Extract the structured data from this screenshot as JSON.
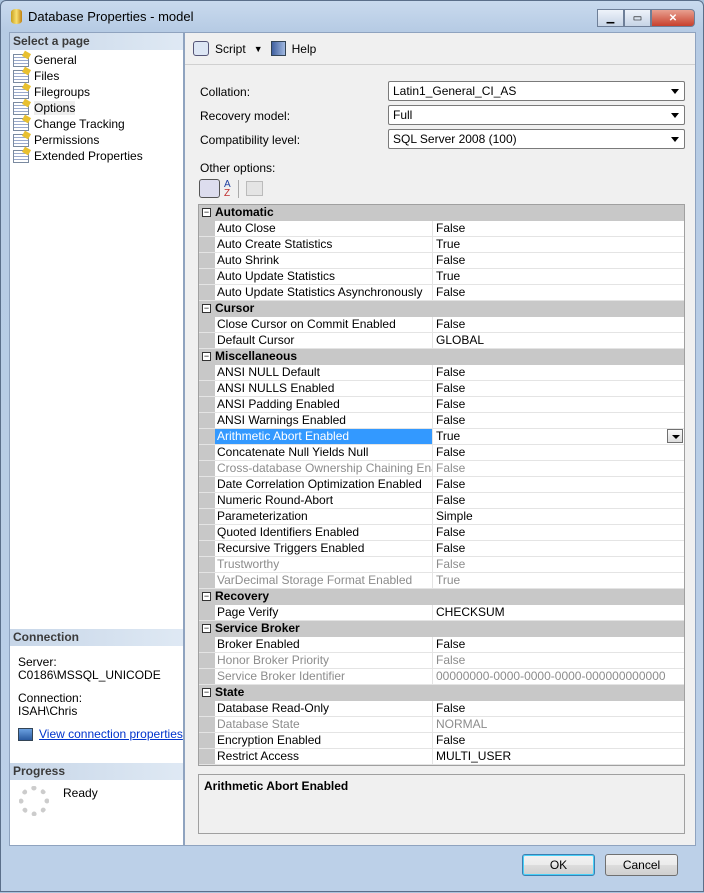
{
  "window": {
    "title": "Database Properties - model"
  },
  "left": {
    "select_header": "Select a page",
    "pages": [
      "General",
      "Files",
      "Filegroups",
      "Options",
      "Change Tracking",
      "Permissions",
      "Extended Properties"
    ],
    "selected": "Options",
    "connection_header": "Connection",
    "server_label": "Server:",
    "server": "C0186\\MSSQL_UNICODE",
    "connection_label": "Connection:",
    "connection": "ISAH\\Chris",
    "view_link": "View connection properties",
    "progress_header": "Progress",
    "progress_status": "Ready"
  },
  "toolbar": {
    "script": "Script",
    "help": "Help"
  },
  "form": {
    "collation_label": "Collation:",
    "collation": "Latin1_General_CI_AS",
    "recovery_label": "Recovery model:",
    "recovery": "Full",
    "compat_label": "Compatibility level:",
    "compat": "SQL Server 2008 (100)",
    "other_label": "Other options:"
  },
  "grid": [
    {
      "category": "Automatic",
      "rows": [
        [
          "Auto Close",
          "False"
        ],
        [
          "Auto Create Statistics",
          "True"
        ],
        [
          "Auto Shrink",
          "False"
        ],
        [
          "Auto Update Statistics",
          "True"
        ],
        [
          "Auto Update Statistics Asynchronously",
          "False"
        ]
      ]
    },
    {
      "category": "Cursor",
      "rows": [
        [
          "Close Cursor on Commit Enabled",
          "False"
        ],
        [
          "Default Cursor",
          "GLOBAL"
        ]
      ]
    },
    {
      "category": "Miscellaneous",
      "rows": [
        [
          "ANSI NULL Default",
          "False"
        ],
        [
          "ANSI NULLS Enabled",
          "False"
        ],
        [
          "ANSI Padding Enabled",
          "False"
        ],
        [
          "ANSI Warnings Enabled",
          "False"
        ],
        [
          "Arithmetic Abort Enabled",
          "True",
          "selected"
        ],
        [
          "Concatenate Null Yields Null",
          "False"
        ],
        [
          "Cross-database Ownership Chaining Enabled",
          "False",
          "disabled"
        ],
        [
          "Date Correlation Optimization Enabled",
          "False"
        ],
        [
          "Numeric Round-Abort",
          "False"
        ],
        [
          "Parameterization",
          "Simple"
        ],
        [
          "Quoted Identifiers Enabled",
          "False"
        ],
        [
          "Recursive Triggers Enabled",
          "False"
        ],
        [
          "Trustworthy",
          "False",
          "disabled"
        ],
        [
          "VarDecimal Storage Format Enabled",
          "True",
          "disabled"
        ]
      ]
    },
    {
      "category": "Recovery",
      "rows": [
        [
          "Page Verify",
          "CHECKSUM"
        ]
      ]
    },
    {
      "category": "Service Broker",
      "rows": [
        [
          "Broker Enabled",
          "False"
        ],
        [
          "Honor Broker Priority",
          "False",
          "disabled"
        ],
        [
          "Service Broker Identifier",
          "00000000-0000-0000-0000-000000000000",
          "disabled"
        ]
      ]
    },
    {
      "category": "State",
      "rows": [
        [
          "Database Read-Only",
          "False"
        ],
        [
          "Database State",
          "NORMAL",
          "disabled"
        ],
        [
          "Encryption Enabled",
          "False"
        ],
        [
          "Restrict Access",
          "MULTI_USER"
        ]
      ]
    }
  ],
  "description": {
    "title": "Arithmetic Abort Enabled"
  },
  "buttons": {
    "ok": "OK",
    "cancel": "Cancel"
  }
}
